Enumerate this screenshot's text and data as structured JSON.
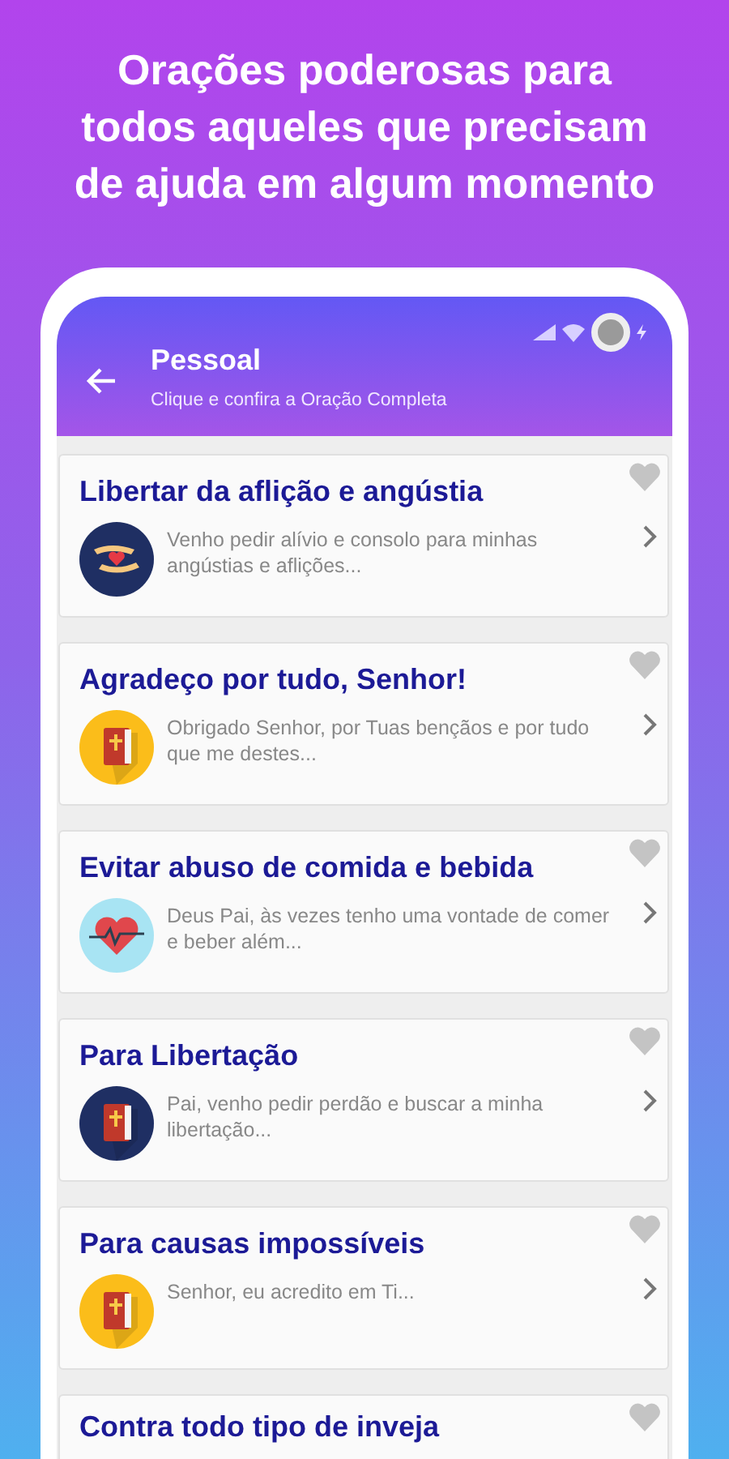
{
  "headline": "Orações poderosas para todos aqueles que precisam de ajuda em algum momento",
  "toolbar": {
    "title": "Pessoal",
    "subtitle": "Clique e confira a Oração Completa"
  },
  "prayers": [
    {
      "title": "Libertar da aflição e angústia",
      "excerpt": "Venho pedir alívio e consolo para minhas angústias e aflições...",
      "kind": "hands",
      "favorite": false
    },
    {
      "title": "Agradeço por tudo, Senhor!",
      "excerpt": "Obrigado Senhor, por Tuas bençãos e por tudo que me destes...",
      "kind": "bible-yellow",
      "favorite": false
    },
    {
      "title": "Evitar abuso de comida e bebida",
      "excerpt": "Deus Pai, às vezes tenho uma vontade de comer e beber além...",
      "kind": "heartbeat",
      "favorite": false
    },
    {
      "title": "Para Libertação",
      "excerpt": "Pai, venho pedir perdão e buscar a minha libertação...",
      "kind": "bible-navy",
      "favorite": false
    },
    {
      "title": "Para causas impossíveis",
      "excerpt": "Senhor, eu acredito em Ti...",
      "kind": "bible-yellow",
      "favorite": false
    },
    {
      "title": "Contra todo tipo de inveja",
      "favorite": false
    }
  ]
}
